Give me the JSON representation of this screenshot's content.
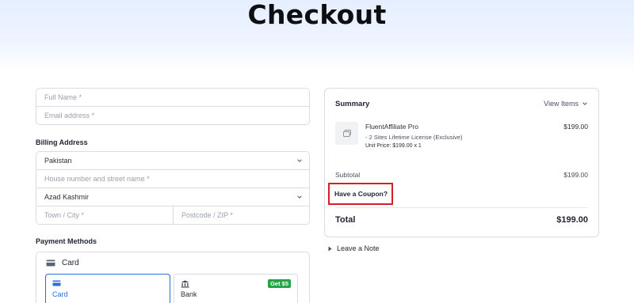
{
  "page": {
    "title": "Checkout"
  },
  "form": {
    "full_name_placeholder": "Full Name *",
    "email_placeholder": "Email address *",
    "billing_label": "Billing Address",
    "country_value": "Pakistan",
    "street_placeholder": "House number and street name *",
    "state_value": "Azad Kashmir",
    "city_placeholder": "Town / City *",
    "postcode_placeholder": "Postcode / ZIP *"
  },
  "payment": {
    "label": "Payment Methods",
    "group_title": "Card",
    "methods": [
      {
        "label": "Card",
        "selected": true,
        "icon": "card-icon"
      },
      {
        "label": "Bank",
        "selected": false,
        "icon": "bank-icon",
        "badge": "Get $5"
      }
    ]
  },
  "summary": {
    "title": "Summary",
    "view_items_label": "View Items",
    "product": {
      "name": "FluentAffiliate Pro",
      "variant": "- 2 Sites Lifetime License (Exclusive)",
      "unit_price_line": "Unit Price: $199.00  x 1",
      "price": "$199.00",
      "thumb_icon": "image-placeholder-icon"
    },
    "subtotal_label": "Subtotal",
    "subtotal_value": "$199.00",
    "coupon_label": "Have a Coupon?",
    "total_label": "Total",
    "total_value": "$199.00"
  },
  "note": {
    "label": "Leave a Note"
  },
  "colors": {
    "accent": "#2a6fdb",
    "highlight": "#d61f26",
    "badge": "#22a447"
  }
}
